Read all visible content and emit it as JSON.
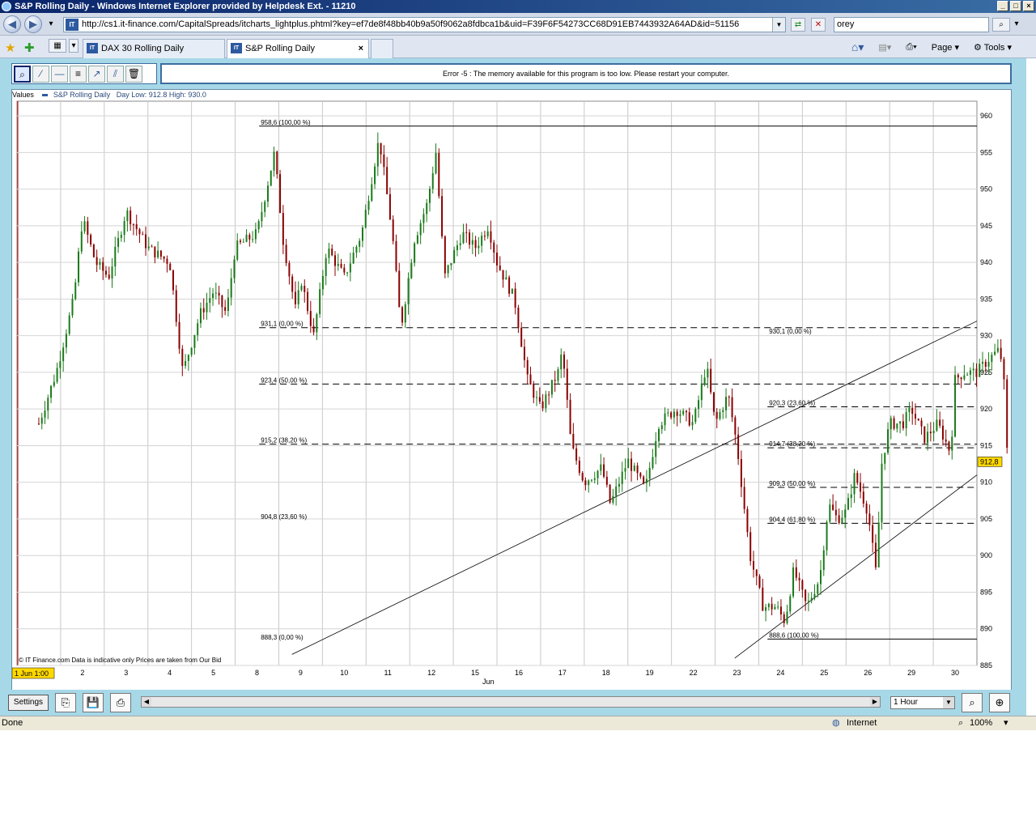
{
  "window": {
    "title": "S&P Rolling Daily - Windows Internet Explorer provided by Helpdesk Ext. - 11210"
  },
  "address": {
    "url": "http://cs1.it-finance.com/CapitalSpreads/itcharts_lightplus.phtml?key=ef7de8f48bb40b9a50f9062a8fdbca1b&uid=F39F6F54273CC68D91EB7443932A64AD&id=51156",
    "search_value": "orey"
  },
  "tabs": [
    {
      "label": "DAX 30 Rolling Daily"
    },
    {
      "label": "S&P Rolling Daily"
    }
  ],
  "ie_tools": {
    "page_label": "Page",
    "tools_label": "Tools"
  },
  "chart_toolbar": {
    "error_message": "Error -5 : The memory available for this program is too low. Please restart your computer."
  },
  "legend": {
    "values_label": "Values",
    "series_label": "S&P Rolling Daily",
    "day_range": "Day Low: 912.8 High: 930.0"
  },
  "footer_note": "© IT Finance.com    Data is indicative only    Prices are taken from Our Bid",
  "cursor_date": "1 Jun 1:00",
  "month_label": "Jun",
  "current_price": "912,8",
  "bottom": {
    "settings_label": "Settings",
    "interval": "1 Hour"
  },
  "status": {
    "left": "Done",
    "zone": "Internet",
    "zoom": "100%"
  },
  "colors": {
    "up": "#1a7a1a",
    "down": "#8a0000",
    "frame": "#a6d8e8",
    "price_tag": "#ffd800"
  },
  "chart_data": {
    "type": "candlestick",
    "ylim": [
      885,
      962
    ],
    "yticks": [
      885,
      890,
      895,
      900,
      905,
      910,
      915,
      920,
      925,
      930,
      935,
      940,
      945,
      950,
      955,
      960
    ],
    "x_tick_labels": [
      "1",
      "2",
      "3",
      "4",
      "5",
      "8",
      "9",
      "10",
      "11",
      "12",
      "15",
      "16",
      "17",
      "18",
      "19",
      "22",
      "23",
      "24",
      "25",
      "26",
      "29",
      "30"
    ],
    "fib_set_1": [
      {
        "label": "958,6 (100,00 %)",
        "value": 958.6,
        "style": "solid"
      },
      {
        "label": "931,1 (0,00 %)",
        "value": 931.1,
        "style": "dashed"
      },
      {
        "label": "923,4 (50,00 %)",
        "value": 923.4,
        "style": "dashed"
      },
      {
        "label": "915,2 (38,20 %)",
        "value": 915.2,
        "style": "dashed"
      },
      {
        "label": "904,8 (23,60 %)",
        "value": 904.8,
        "style": "none"
      },
      {
        "label": "888,3 (0,00 %)",
        "value": 888.3,
        "style": "none"
      }
    ],
    "fib_set_2": [
      {
        "label": "930,1 (0,00 %)",
        "value": 930.1,
        "style": "none"
      },
      {
        "label": "920,3 (23,60 %)",
        "value": 920.3,
        "style": "dashed"
      },
      {
        "label": "914,7 (38,20 %)",
        "value": 914.7,
        "style": "dashed"
      },
      {
        "label": "909,3 (50,00 %)",
        "value": 909.3,
        "style": "dashed"
      },
      {
        "label": "904,4 (61,80 %)",
        "value": 904.4,
        "style": "dashed"
      },
      {
        "label": "888,6 (100,00 %)",
        "value": 888.6,
        "style": "solid"
      }
    ],
    "path_points": [
      {
        "d": 0,
        "v": 918
      },
      {
        "d": 0.4,
        "v": 925
      },
      {
        "d": 0.8,
        "v": 935
      },
      {
        "d": 1.0,
        "v": 946
      },
      {
        "d": 1.3,
        "v": 940
      },
      {
        "d": 1.6,
        "v": 938
      },
      {
        "d": 2.0,
        "v": 947
      },
      {
        "d": 2.5,
        "v": 942
      },
      {
        "d": 3.0,
        "v": 940
      },
      {
        "d": 3.3,
        "v": 925
      },
      {
        "d": 3.7,
        "v": 933
      },
      {
        "d": 4.0,
        "v": 936
      },
      {
        "d": 4.3,
        "v": 933
      },
      {
        "d": 4.5,
        "v": 942
      },
      {
        "d": 5.0,
        "v": 944
      },
      {
        "d": 5.4,
        "v": 955
      },
      {
        "d": 5.6,
        "v": 943
      },
      {
        "d": 5.9,
        "v": 933
      },
      {
        "d": 6.0,
        "v": 938
      },
      {
        "d": 6.3,
        "v": 930
      },
      {
        "d": 6.6,
        "v": 942
      },
      {
        "d": 7.0,
        "v": 938
      },
      {
        "d": 7.4,
        "v": 944
      },
      {
        "d": 7.8,
        "v": 957
      },
      {
        "d": 8.1,
        "v": 944
      },
      {
        "d": 8.3,
        "v": 931
      },
      {
        "d": 8.6,
        "v": 943
      },
      {
        "d": 8.9,
        "v": 948
      },
      {
        "d": 9.1,
        "v": 955
      },
      {
        "d": 9.3,
        "v": 938
      },
      {
        "d": 9.7,
        "v": 944
      },
      {
        "d": 10.0,
        "v": 942
      },
      {
        "d": 10.3,
        "v": 945
      },
      {
        "d": 10.5,
        "v": 940
      },
      {
        "d": 10.9,
        "v": 935
      },
      {
        "d": 11.2,
        "v": 924
      },
      {
        "d": 11.5,
        "v": 920
      },
      {
        "d": 11.9,
        "v": 925
      },
      {
        "d": 12.0,
        "v": 928
      },
      {
        "d": 12.2,
        "v": 915
      },
      {
        "d": 12.5,
        "v": 910
      },
      {
        "d": 12.9,
        "v": 912
      },
      {
        "d": 13.1,
        "v": 907
      },
      {
        "d": 13.5,
        "v": 913
      },
      {
        "d": 13.9,
        "v": 909
      },
      {
        "d": 14.2,
        "v": 918
      },
      {
        "d": 14.6,
        "v": 920
      },
      {
        "d": 15.0,
        "v": 918
      },
      {
        "d": 15.3,
        "v": 926
      },
      {
        "d": 15.5,
        "v": 918
      },
      {
        "d": 15.8,
        "v": 922
      },
      {
        "d": 16.0,
        "v": 915
      },
      {
        "d": 16.3,
        "v": 900
      },
      {
        "d": 16.6,
        "v": 893
      },
      {
        "d": 16.9,
        "v": 893
      },
      {
        "d": 17.1,
        "v": 891
      },
      {
        "d": 17.3,
        "v": 898
      },
      {
        "d": 17.6,
        "v": 893
      },
      {
        "d": 17.9,
        "v": 897
      },
      {
        "d": 18.1,
        "v": 907
      },
      {
        "d": 18.3,
        "v": 905
      },
      {
        "d": 18.5,
        "v": 906
      },
      {
        "d": 18.7,
        "v": 911
      },
      {
        "d": 19.0,
        "v": 906
      },
      {
        "d": 19.2,
        "v": 897
      },
      {
        "d": 19.3,
        "v": 912
      },
      {
        "d": 19.5,
        "v": 918
      },
      {
        "d": 19.8,
        "v": 918
      },
      {
        "d": 20.0,
        "v": 920
      },
      {
        "d": 20.3,
        "v": 916
      },
      {
        "d": 20.6,
        "v": 918
      },
      {
        "d": 20.9,
        "v": 914
      },
      {
        "d": 21.0,
        "v": 924
      },
      {
        "d": 21.2,
        "v": 925
      },
      {
        "d": 21.5,
        "v": 925
      },
      {
        "d": 21.8,
        "v": 927
      },
      {
        "d": 22.0,
        "v": 928
      },
      {
        "d": 22.1,
        "v": 926
      },
      {
        "d": 22.2,
        "v": 913
      }
    ],
    "trend_lines": [
      {
        "from": {
          "d": 5.8,
          "v": 886.5
        },
        "to": {
          "d": 22.8,
          "v": 932
        }
      },
      {
        "from": {
          "d": 15.95,
          "v": 886
        },
        "to": {
          "d": 22.8,
          "v": 911
        }
      }
    ],
    "current_price": 912.8
  }
}
